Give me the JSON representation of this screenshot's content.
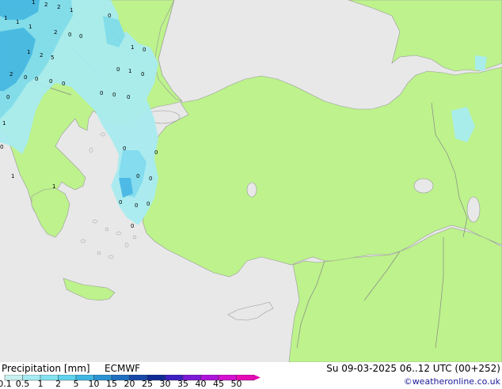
{
  "footer": {
    "title": "Precipitation [mm]",
    "model": "ECMWF",
    "validity": "Su 09-03-2025 06..12 UTC (00+252)",
    "credit": "©weatheronline.co.uk"
  },
  "legend": {
    "ticks": [
      "0.1",
      "0.5",
      "1",
      "2",
      "5",
      "10",
      "15",
      "20",
      "25",
      "30",
      "35",
      "40",
      "45",
      "50"
    ],
    "colors": [
      "#c8f0f0",
      "#a6ecf2",
      "#84e2ef",
      "#5fd2ec",
      "#3fb6e4",
      "#2b93d2",
      "#1f6fbf",
      "#1849a8",
      "#0f2a94",
      "#3d1fc2",
      "#7a1ad6",
      "#ad14d9",
      "#d40fd0",
      "#e60ab4"
    ]
  },
  "map": {
    "colors": {
      "sea": "#e8e8e8",
      "land": "#bdf28c",
      "precip_light": "#a8ecf0",
      "precip_mid": "#7fdcef",
      "precip_heavy": "#45b8e6",
      "border": "#888888"
    },
    "precip_labels": [
      {
        "text": "1"
      },
      {
        "text": "2"
      },
      {
        "text": "2"
      },
      {
        "text": "1"
      },
      {
        "text": "1"
      },
      {
        "text": "1"
      },
      {
        "text": "1"
      },
      {
        "text": "2"
      },
      {
        "text": "0"
      },
      {
        "text": "0"
      },
      {
        "text": "0"
      },
      {
        "text": "1"
      },
      {
        "text": "0"
      },
      {
        "text": "1"
      },
      {
        "text": "2"
      },
      {
        "text": "5"
      },
      {
        "text": "2"
      },
      {
        "text": "0"
      },
      {
        "text": "0"
      },
      {
        "text": "0"
      },
      {
        "text": "0"
      },
      {
        "text": "0"
      },
      {
        "text": "1"
      },
      {
        "text": "0"
      },
      {
        "text": "0"
      },
      {
        "text": "0"
      },
      {
        "text": "0"
      },
      {
        "text": "0"
      },
      {
        "text": "1"
      },
      {
        "text": "0"
      },
      {
        "text": "0"
      },
      {
        "text": "0"
      },
      {
        "text": "0"
      },
      {
        "text": "1"
      },
      {
        "text": "1"
      },
      {
        "text": "0"
      },
      {
        "text": "0"
      },
      {
        "text": "0"
      },
      {
        "text": "0"
      },
      {
        "text": "0"
      }
    ]
  }
}
